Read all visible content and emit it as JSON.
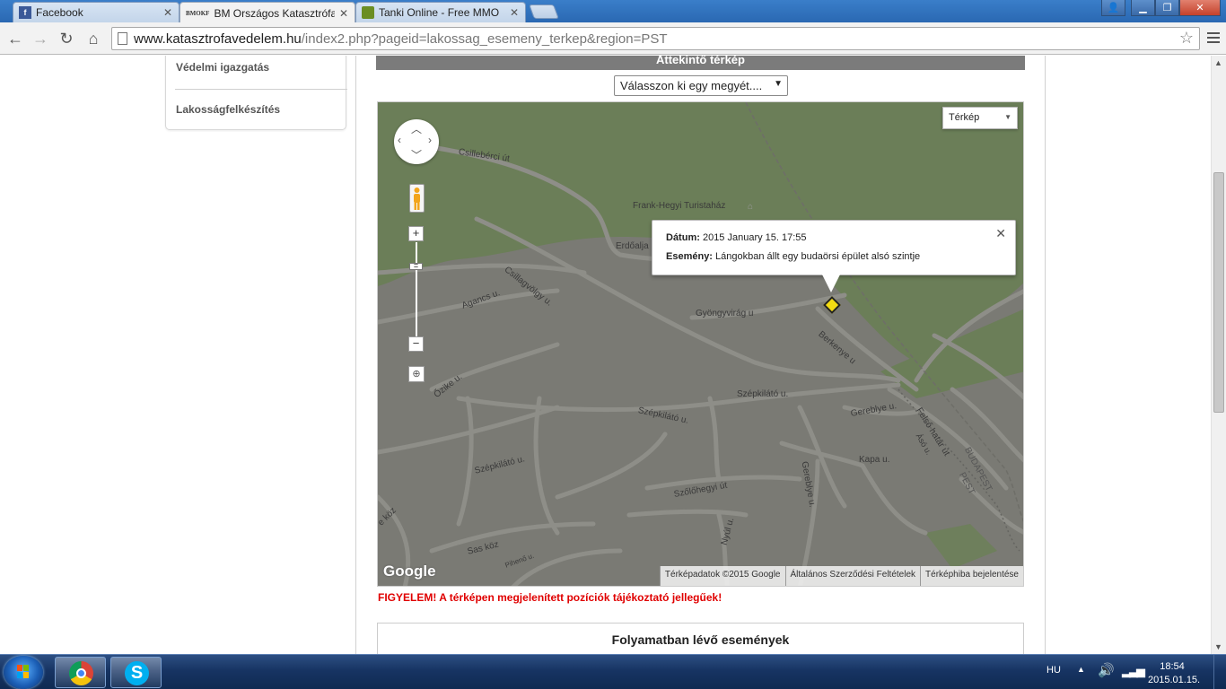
{
  "browser": {
    "tabs": [
      {
        "label": "Facebook",
        "icon": "facebook-icon",
        "active": false
      },
      {
        "label": "BM Országos Katasztrófav",
        "icon_text": "BMOKF",
        "active": true
      },
      {
        "label": "Tanki Online - Free MMO",
        "icon": "tank-icon",
        "active": false
      }
    ],
    "url_host": "www.katasztrofavedelem.hu",
    "url_path": "/index2.php?pageid=lakossag_esemeny_terkep&region=PST"
  },
  "sidebar": {
    "items": [
      {
        "label": "Védelmi igazgatás"
      },
      {
        "label": "Lakosságfelkészítés"
      }
    ]
  },
  "content": {
    "section_title": "Áttekintő térkép",
    "county_select": "Válasszon ki egy megyét....",
    "warning": "FIGYELEM! A térképen megjelenített pozíciók tájékoztató jellegűek!",
    "ongoing_title": "Folyamatban lévő események"
  },
  "map": {
    "map_type": "Térkép",
    "info": {
      "date_label": "Dátum:",
      "date_value": "2015 January 15. 17:55",
      "event_label": "Esemény:",
      "event_value": "Lángokban állt egy budaörsi épület alsó szintje"
    },
    "streets": [
      "Csillebérci út",
      "Frank-Hegyi Turistaház",
      "Erdőalja",
      "Csillagvölgy u.",
      "Agancs u.",
      "Gyöngyvirág u",
      "Berkenye u",
      "Őzike u.",
      "Szépkilátó u.",
      "Szépkilátó u.",
      "Szépkilátó u.",
      "Gereblye u.",
      "Felső határ út",
      "Ásó u.",
      "BUDAPEST",
      "PEST",
      "Kapa u.",
      "Gereblye u.",
      "Szőlőhegyi út",
      "Nyúl u.",
      "Sas köz",
      "Pihenő u.",
      "e köz"
    ],
    "google_logo": "Google",
    "attribution": [
      "Térképadatok ©2015 Google",
      "Általános Szerződési Feltételek",
      "Térképhiba bejelentése"
    ],
    "colors": {
      "forest": "#6b7e58",
      "urban": "#7a7a74",
      "road": "#8c8c86",
      "marker": "#f4dc12"
    }
  },
  "taskbar": {
    "language": "HU",
    "time": "18:54",
    "date": "2015.01.15."
  }
}
